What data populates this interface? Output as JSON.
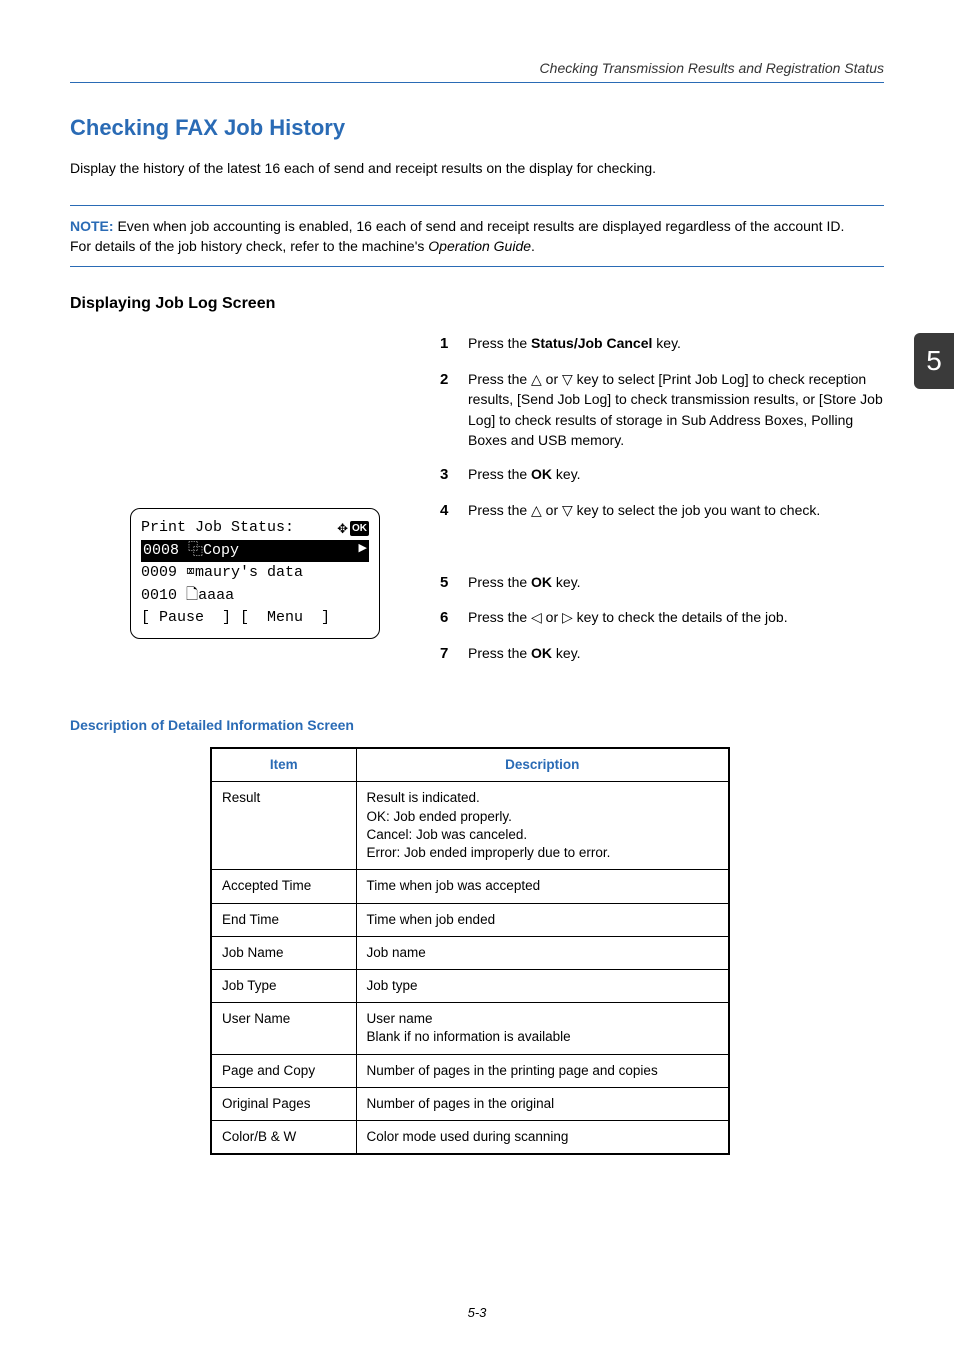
{
  "header": {
    "running_title": "Checking Transmission Results and Registration Status"
  },
  "page_tab": "5",
  "title": "Checking FAX Job History",
  "intro": "Display the history of the latest 16 each of send and receipt results on the display for checking.",
  "note": {
    "label": "NOTE:",
    "line1": " Even when job accounting is enabled, 16 each of send and receipt results are displayed regardless of the account ID.",
    "line2": "For details of the job history check, refer to the machine's ",
    "op_guide": "Operation Guide",
    "period": "."
  },
  "subheading": "Displaying Job Log Screen",
  "steps": {
    "s1a": "Press the ",
    "s1b": "Status/Job Cancel",
    "s1c": " key.",
    "s2": "Press the △ or ▽ key to select [Print Job Log] to check reception results, [Send Job Log] to check transmission results, or [Store Job Log] to check results of storage in Sub Address Boxes, Polling Boxes and USB memory.",
    "s3a": "Press the ",
    "s3b": "OK",
    "s3c": " key.",
    "s4": "Press the △ or ▽ key to select the job you want to check.",
    "s5a": "Press the ",
    "s5b": "OK",
    "s5c": " key.",
    "s6": "Press the ◁ or ▷ key to check the details of the job.",
    "s7a": "Press the ",
    "s7b": "OK",
    "s7c": " key."
  },
  "lcd": {
    "title": "Print Job Status:",
    "ok": "OK",
    "row1_left": "0008 ⿻Copy",
    "row1_arrow": "▶",
    "row2": "0009 ⌧maury's data",
    "row3": "0010 🗋aaaa",
    "row4": "[ Pause  ] [  Menu  ]"
  },
  "desc_heading": "Description of Detailed Information Screen",
  "table": {
    "head_item": "Item",
    "head_desc": "Description",
    "rows": [
      {
        "item": "Result",
        "desc": "Result is indicated.\nOK: Job ended properly.\nCancel: Job was canceled.\nError: Job ended improperly due to error."
      },
      {
        "item": "Accepted Time",
        "desc": "Time when job was accepted"
      },
      {
        "item": "End Time",
        "desc": "Time when job ended"
      },
      {
        "item": "Job Name",
        "desc": "Job name"
      },
      {
        "item": "Job Type",
        "desc": "Job type"
      },
      {
        "item": "User Name",
        "desc": "User name\nBlank if no information is available"
      },
      {
        "item": "Page and Copy",
        "desc": "Number of pages in the printing page and copies"
      },
      {
        "item": "Original Pages",
        "desc": "Number of pages in the original"
      },
      {
        "item": "Color/B & W",
        "desc": "Color mode used during scanning"
      }
    ]
  },
  "footer": "5-3",
  "chart_data": {
    "type": "table",
    "title": "Description of Detailed Information Screen",
    "columns": [
      "Item",
      "Description"
    ],
    "rows": [
      [
        "Result",
        "Result is indicated. OK: Job ended properly. Cancel: Job was canceled. Error: Job ended improperly due to error."
      ],
      [
        "Accepted Time",
        "Time when job was accepted"
      ],
      [
        "End Time",
        "Time when job ended"
      ],
      [
        "Job Name",
        "Job name"
      ],
      [
        "Job Type",
        "Job type"
      ],
      [
        "User Name",
        "User name. Blank if no information is available"
      ],
      [
        "Page and Copy",
        "Number of pages in the printing page and copies"
      ],
      [
        "Original Pages",
        "Number of pages in the original"
      ],
      [
        "Color/B & W",
        "Color mode used during scanning"
      ]
    ]
  }
}
